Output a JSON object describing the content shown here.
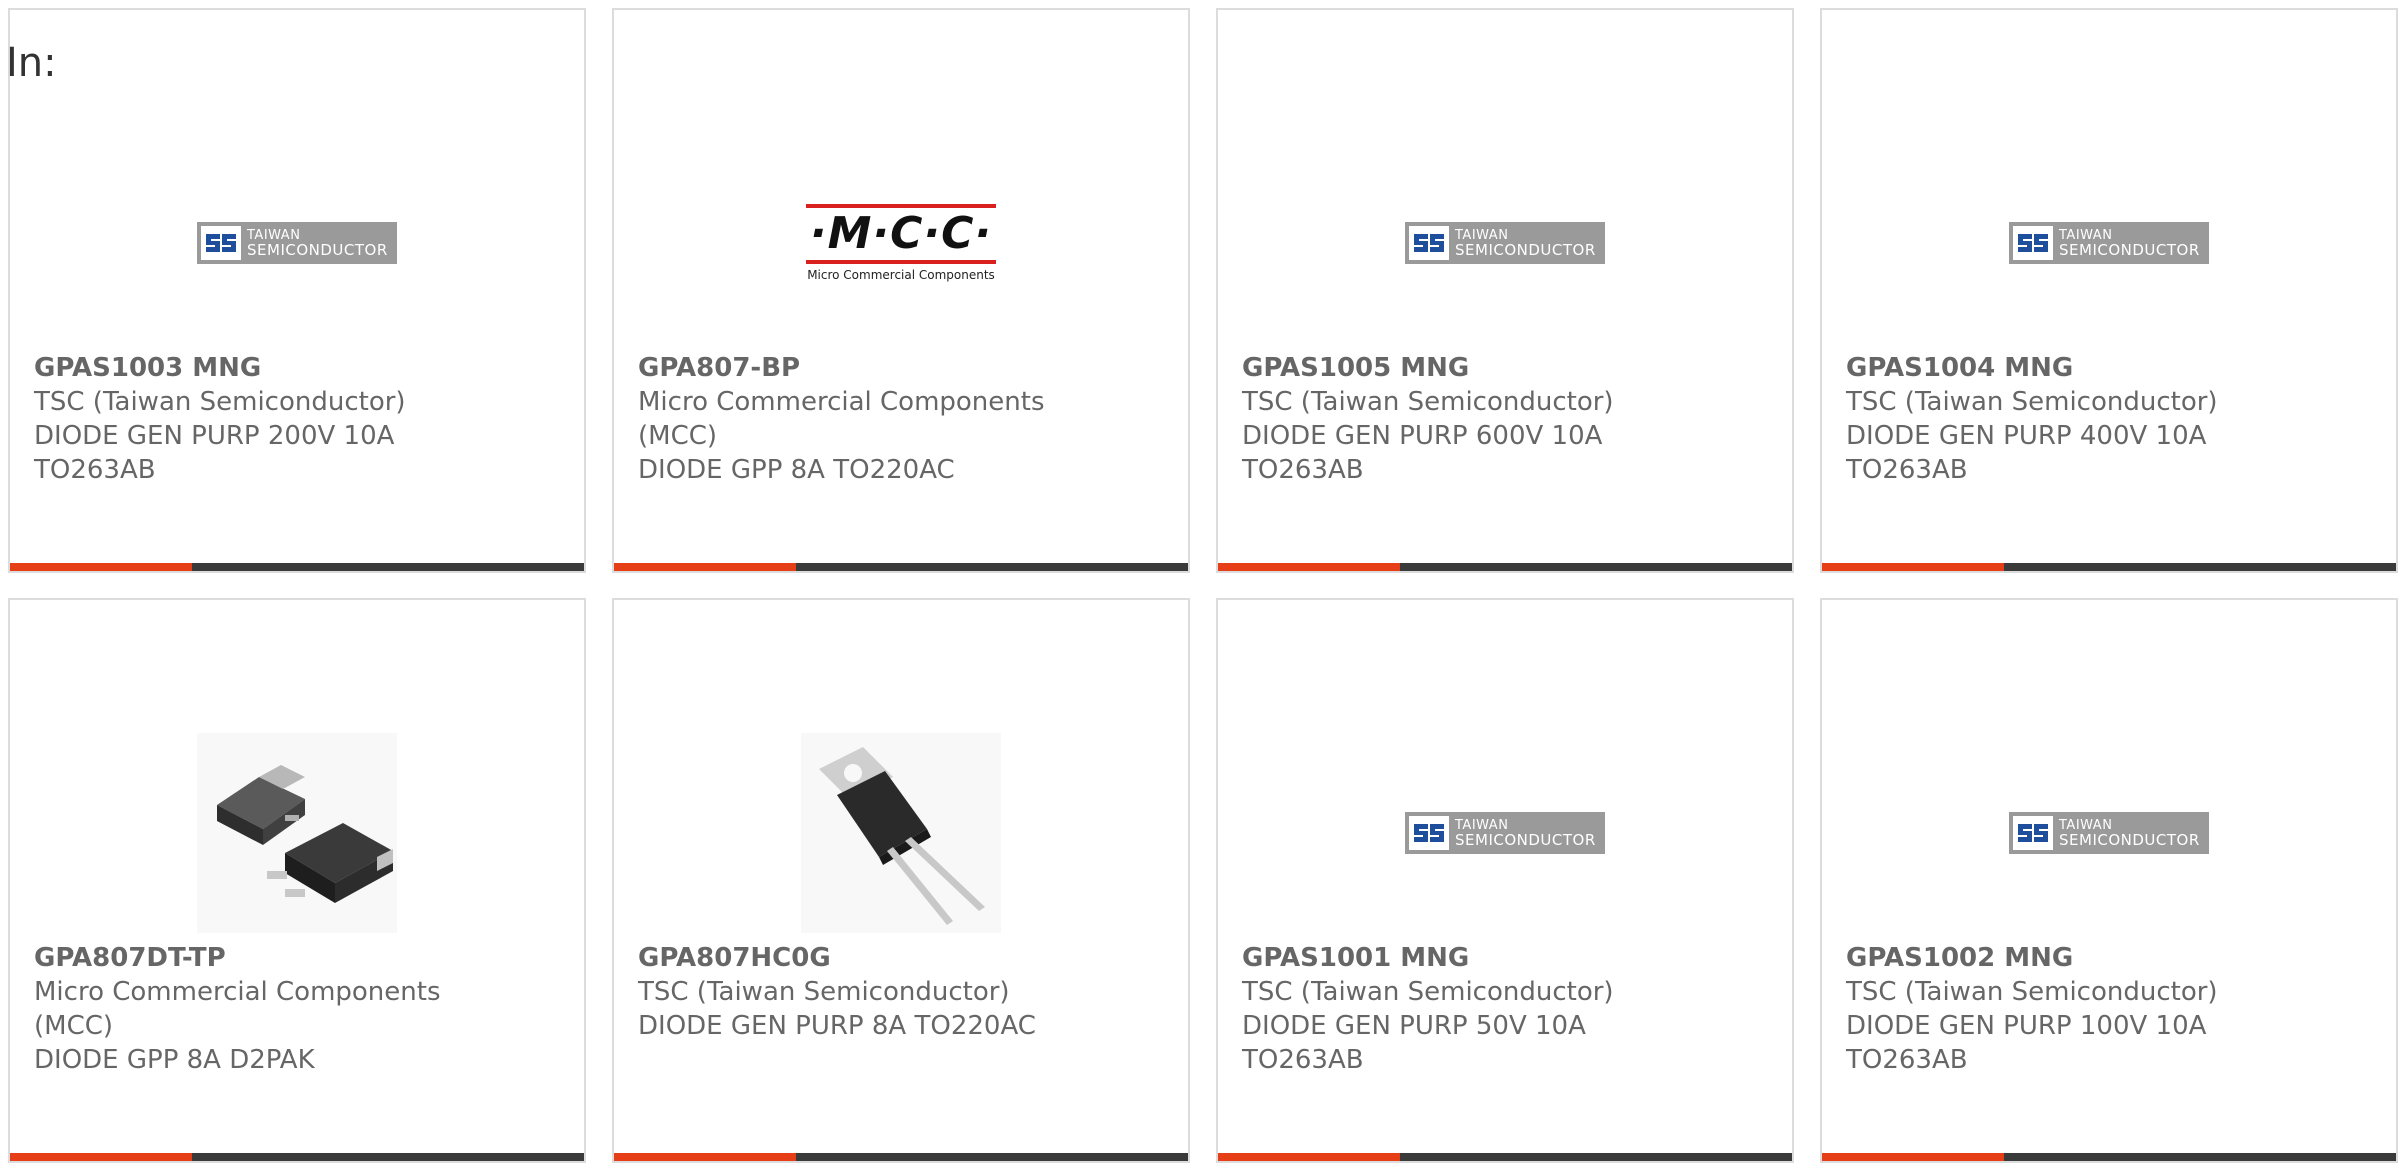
{
  "page": {
    "label": "In:"
  },
  "logos": {
    "tsc_line1": "TAIWAN",
    "tsc_line2": "SEMICONDUCTOR",
    "mcc_mark": "·M·C·C·",
    "mcc_subtitle": "Micro Commercial Components"
  },
  "colors": {
    "accent": "#e63e16",
    "bar": "#3a3a3a",
    "text": "#666666",
    "border": "#dcdcdc"
  },
  "products": [
    {
      "part_number": "GPAS1003 MNG",
      "manufacturer": "TSC (Taiwan Semiconductor)",
      "description": "DIODE GEN PURP 200V 10A TO263AB",
      "image": "tsc-logo"
    },
    {
      "part_number": "GPA807-BP",
      "manufacturer": "Micro Commercial Components (MCC)",
      "description": "DIODE GPP 8A TO220AC",
      "image": "mcc-logo"
    },
    {
      "part_number": "GPAS1005 MNG",
      "manufacturer": "TSC (Taiwan Semiconductor)",
      "description": "DIODE GEN PURP 600V 10A TO263AB",
      "image": "tsc-logo"
    },
    {
      "part_number": "GPAS1004 MNG",
      "manufacturer": "TSC (Taiwan Semiconductor)",
      "description": "DIODE GEN PURP 400V 10A TO263AB",
      "image": "tsc-logo"
    },
    {
      "part_number": "GPA807DT-TP",
      "manufacturer": "Micro Commercial Components (MCC)",
      "description": "DIODE GPP 8A D2PAK",
      "image": "d2pak-photo"
    },
    {
      "part_number": "GPA807HC0G",
      "manufacturer": "TSC (Taiwan Semiconductor)",
      "description": "DIODE GEN PURP 8A TO220AC",
      "image": "to220-photo"
    },
    {
      "part_number": "GPAS1001 MNG",
      "manufacturer": "TSC (Taiwan Semiconductor)",
      "description": "DIODE GEN PURP 50V 10A TO263AB",
      "image": "tsc-logo"
    },
    {
      "part_number": "GPAS1002 MNG",
      "manufacturer": "TSC (Taiwan Semiconductor)",
      "description": "DIODE GEN PURP 100V 10A TO263AB",
      "image": "tsc-logo"
    }
  ]
}
